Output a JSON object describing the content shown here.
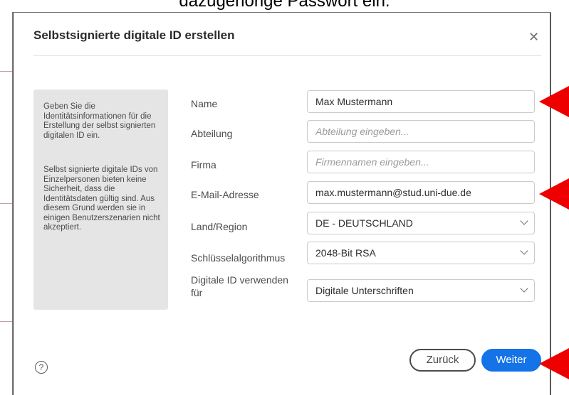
{
  "caption": "dazugehörige Passwort ein.",
  "dialog": {
    "title": "Selbstsignierte digitale ID erstellen",
    "close_icon": "close-icon"
  },
  "info": {
    "paragraph1": "Geben Sie die Identitätsinformationen für die Erstellung der selbst signierten digitalen ID ein.",
    "paragraph2": "Selbst signierte digitale IDs von Einzelpersonen bieten keine Sicherheit, dass die Identitätsdaten gültig sind. Aus diesem Grund werden sie in einigen Benutzerszenarien nicht akzeptiert."
  },
  "form": {
    "name": {
      "label": "Name",
      "value": "Max Mustermann"
    },
    "department": {
      "label": "Abteilung",
      "value": "",
      "placeholder": "Abteilung eingeben..."
    },
    "company": {
      "label": "Firma",
      "value": "",
      "placeholder": "Firmennamen eingeben..."
    },
    "email": {
      "label": "E-Mail-Adresse",
      "value": "max.mustermann@stud.uni-due.de"
    },
    "country": {
      "label": "Land/Region",
      "value": "DE - DEUTSCHLAND"
    },
    "key_algorithm": {
      "label": "Schlüsselalgorithmus",
      "value": "2048-Bit RSA"
    },
    "usage": {
      "label_line1": "Digitale ID verwenden",
      "label_line2": "für",
      "value": "Digitale Unterschriften"
    }
  },
  "footer": {
    "help_glyph": "?",
    "back_label": "Zurück",
    "next_label": "Weiter"
  },
  "colors": {
    "accent": "#1473e6",
    "annotation_arrow": "#ee0000",
    "info_panel": "#e5e5e5"
  }
}
